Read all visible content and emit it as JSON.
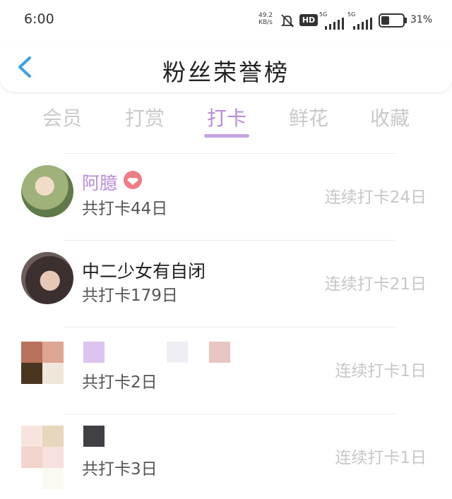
{
  "status": {
    "time": "6:00",
    "speed_value": "49.2",
    "speed_unit": "KB/s",
    "hd_label": "HD",
    "network_1": "5G",
    "network_2": "5G",
    "battery": "31%"
  },
  "header": {
    "title": "粉丝荣誉榜"
  },
  "tabs": [
    {
      "label": "会员"
    },
    {
      "label": "打赏"
    },
    {
      "label": "打卡",
      "active": true
    },
    {
      "label": "鲜花"
    },
    {
      "label": "收藏"
    }
  ],
  "rows": [
    {
      "name": "阿臆",
      "total": "共打卡44日",
      "streak": "连续打卡24日",
      "name_color": "#b98bd8",
      "vip": true
    },
    {
      "name": "中二少女有自闭",
      "total": "共打卡179日",
      "streak": "连续打卡21日",
      "name_color": "#222222"
    },
    {
      "name": "",
      "total": "共打卡2日",
      "streak": "连续打卡1日"
    },
    {
      "name": "",
      "total": "共打卡3日",
      "streak": "连续打卡1日"
    }
  ],
  "colors": {
    "accent": "#b98bd8",
    "muted": "#c7c7c7",
    "back": "#3aa0e8",
    "vip": "#ef7d85"
  }
}
